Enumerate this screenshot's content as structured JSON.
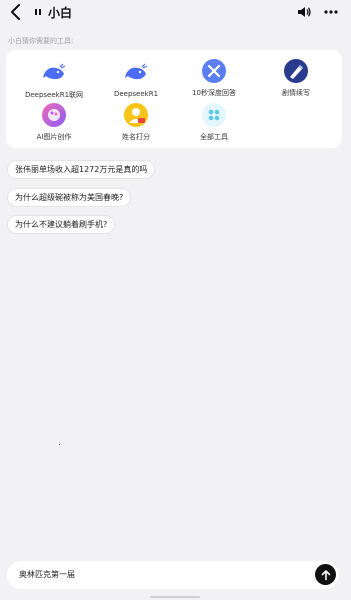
{
  "header": {
    "agent_name": "小白",
    "icons": {
      "back": "chevron-left-icon",
      "agent": "pause-icon",
      "speaker": "speaker-icon",
      "more": "more-dots-icon"
    }
  },
  "hint_text": "小白猜你需要的工具:",
  "tools": [
    {
      "label": "DeepseekR1联网",
      "icon": "whale-icon",
      "color": "#4a6cf7"
    },
    {
      "label": "DeepseekR1",
      "icon": "whale-icon",
      "color": "#4a6cf7"
    },
    {
      "label": "10秒深度回答",
      "icon": "rocket-icon",
      "color": "#5b7ff2"
    },
    {
      "label": "剧情续写",
      "icon": "pen-icon",
      "color": "#2a3a8c"
    },
    {
      "label": "AI图片创作",
      "icon": "palette-icon",
      "color": "#b35cf0"
    },
    {
      "label": "姓名打分",
      "icon": "badge-icon",
      "color": "#f5c518"
    },
    {
      "label": "全部工具",
      "icon": "grid-icon",
      "color": "#5ec7e6"
    }
  ],
  "suggestions": [
    "张伟丽单场收入超1272万元是真的吗",
    "为什么超级碗被称为美国春晚?",
    "为什么不建议躺着刷手机?"
  ],
  "input": {
    "value": "奥林匹克第一届",
    "send_icon": "arrow-up-icon"
  }
}
